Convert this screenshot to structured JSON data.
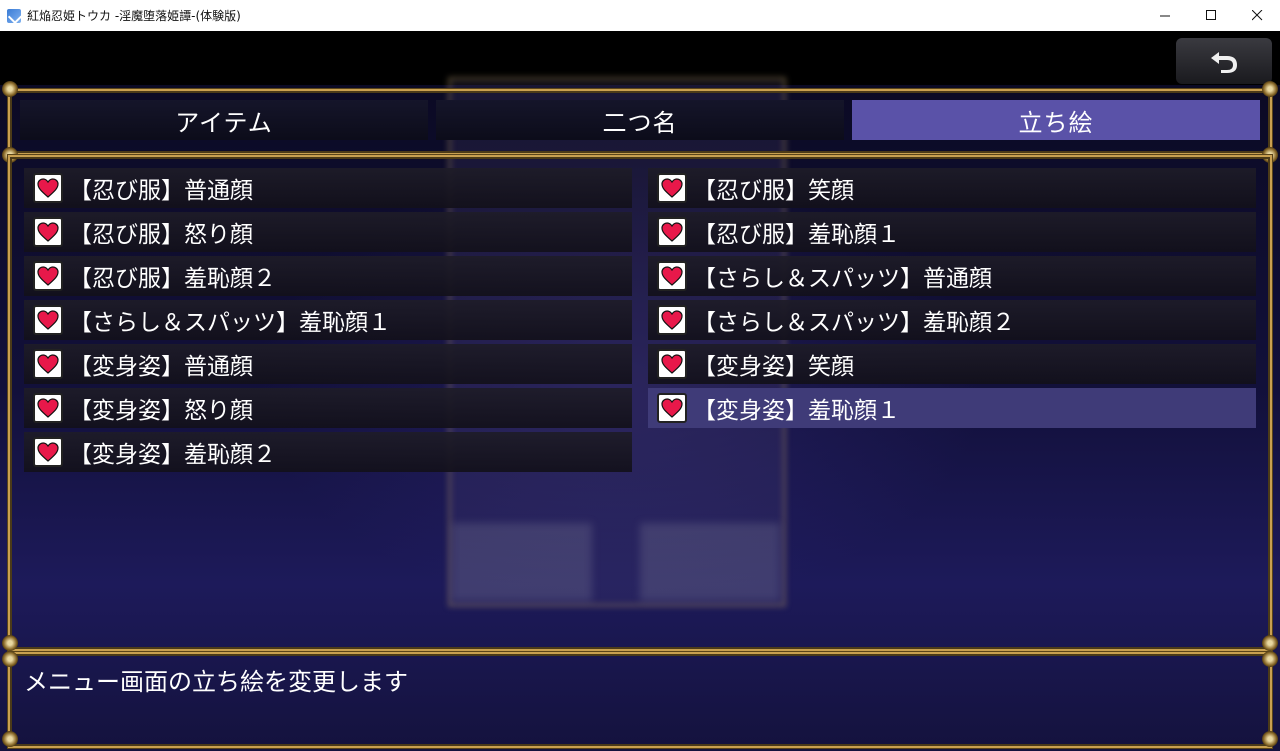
{
  "window": {
    "title": "紅焔忍姫トウカ -淫魔堕落姫譚-(体験版)",
    "minimize": "—",
    "maximize": "☐",
    "close": "✕"
  },
  "back_button": {
    "icon": "undo-arrow-icon"
  },
  "tabs": [
    {
      "label": "アイテム",
      "active": false
    },
    {
      "label": "二つ名",
      "active": false
    },
    {
      "label": "立ち絵",
      "active": true
    }
  ],
  "items": [
    {
      "label": "【忍び服】普通顔",
      "icon": "heart-icon"
    },
    {
      "label": "【忍び服】笑顔",
      "icon": "heart-icon"
    },
    {
      "label": "【忍び服】怒り顔",
      "icon": "heart-icon"
    },
    {
      "label": "【忍び服】羞恥顔１",
      "icon": "heart-icon"
    },
    {
      "label": "【忍び服】羞恥顔２",
      "icon": "heart-icon"
    },
    {
      "label": "【さらし＆スパッツ】普通顔",
      "icon": "heart-icon"
    },
    {
      "label": "【さらし＆スパッツ】羞恥顔１",
      "icon": "heart-icon"
    },
    {
      "label": "【さらし＆スパッツ】羞恥顔２",
      "icon": "heart-icon"
    },
    {
      "label": "【変身姿】普通顔",
      "icon": "heart-icon"
    },
    {
      "label": "【変身姿】笑顔",
      "icon": "heart-icon"
    },
    {
      "label": "【変身姿】怒り顔",
      "icon": "heart-icon"
    },
    {
      "label": "【変身姿】羞恥顔１",
      "icon": "heart-icon",
      "selected": true
    },
    {
      "label": "【変身姿】羞恥顔２",
      "icon": "heart-icon"
    }
  ],
  "help_text": "メニュー画面の立ち絵を変更します",
  "colors": {
    "frame_gold": "#c9a050",
    "tab_active": "#5a52a8",
    "row_selected": "#3f3b78",
    "heart": "#e8184a"
  }
}
